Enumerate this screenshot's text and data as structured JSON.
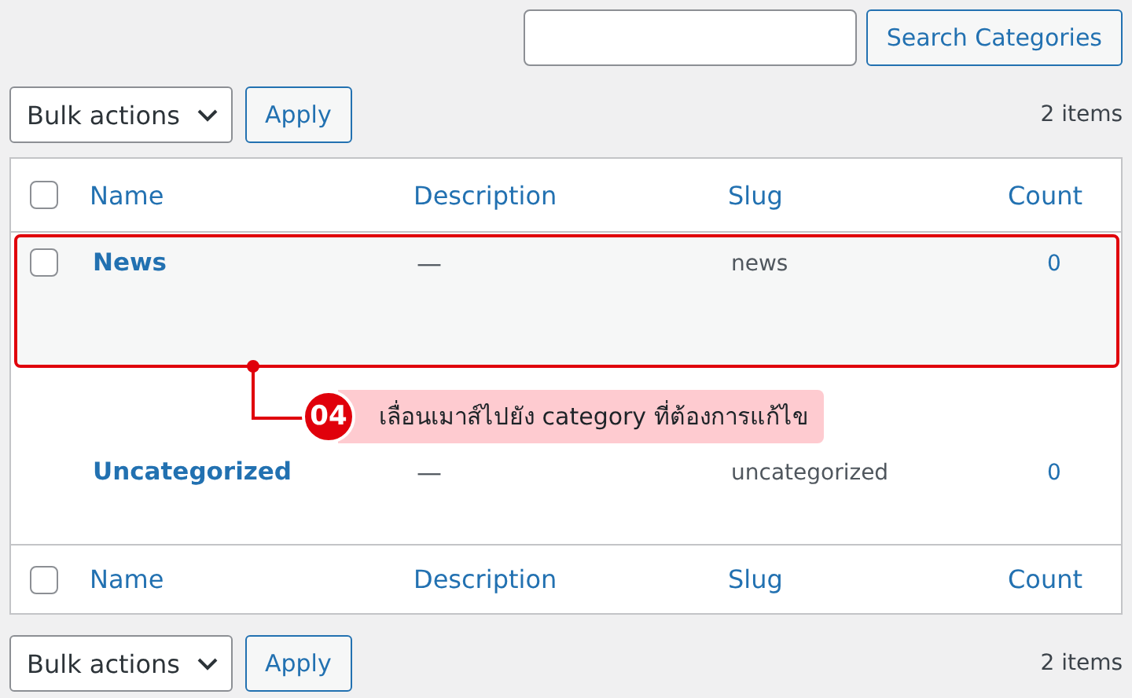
{
  "search": {
    "button": "Search Categories"
  },
  "top_toolbar": {
    "bulk_actions": "Bulk actions",
    "apply": "Apply",
    "count": "2 items"
  },
  "table": {
    "select_all": {
      "checked": false
    },
    "columns": [
      "Name",
      "Description",
      "Slug",
      "Count"
    ],
    "rows": [
      {
        "name": "News",
        "description": "—",
        "slug": "news",
        "count": "0",
        "checkbox": {
          "checked": false
        },
        "hovered": true
      },
      {
        "name": "Uncategorized",
        "description": "—",
        "slug": "uncategorized",
        "count": "0",
        "hovered": false
      }
    ],
    "footer_select_all": {
      "checked": false
    },
    "footer_columns": [
      "Name",
      "Description",
      "Slug",
      "Count"
    ]
  },
  "annotation": {
    "number": "04",
    "text": "เลื่อนเมาส์ไปยัง category ที่ต้องการแก้ไข"
  },
  "bottom_toolbar": {
    "bulk_actions": "Bulk actions",
    "apply": "Apply",
    "count": "2 items"
  }
}
